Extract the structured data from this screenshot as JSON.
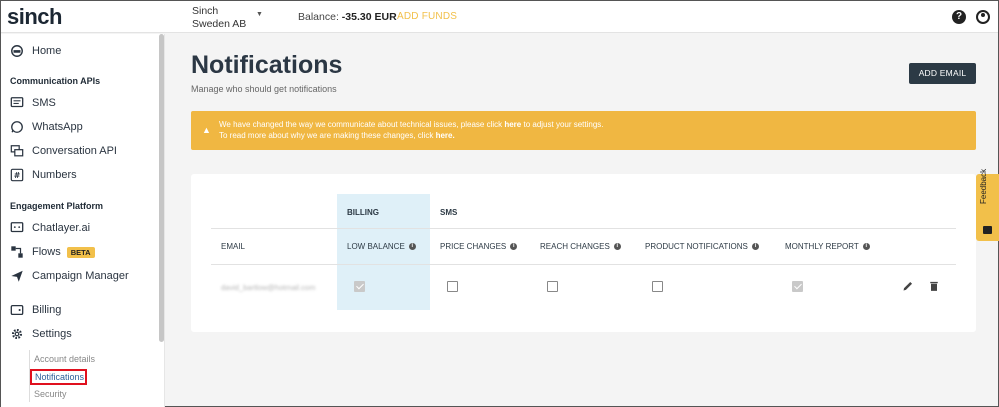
{
  "header": {
    "logo": "sinch",
    "account": "Sinch Sweden AB",
    "balance_label": "Balance:",
    "balance_value": "-35.30 EUR",
    "add_funds": "ADD FUNDS"
  },
  "sidebar": {
    "home": "Home",
    "section1": "Communication APIs",
    "sms": "SMS",
    "whatsapp": "WhatsApp",
    "conversation": "Conversation API",
    "numbers": "Numbers",
    "section2": "Engagement Platform",
    "chatlayer": "Chatlayer.ai",
    "flows": "Flows",
    "flows_badge": "BETA",
    "campaign": "Campaign Manager",
    "billing": "Billing",
    "settings": "Settings",
    "sub": [
      "Account details",
      "Notifications",
      "Security"
    ]
  },
  "page": {
    "title": "Notifications",
    "subtitle": "Manage who should get notifications",
    "add_email": "ADD EMAIL"
  },
  "alert": {
    "line1_a": "We have changed the way we communicate about technical issues, please click ",
    "line1_link": "here",
    "line1_b": " to adjust your settings.",
    "line2_a": "To read more about why we are making these changes, click ",
    "line2_link": "here."
  },
  "table": {
    "groups": [
      "BILLING",
      "SMS"
    ],
    "columns": [
      "EMAIL",
      "LOW BALANCE",
      "PRICE CHANGES",
      "REACH CHANGES",
      "PRODUCT NOTIFICATIONS",
      "MONTHLY REPORT"
    ],
    "row": {
      "email": "david_bartlow@hotmail.com",
      "low_balance": true,
      "price_changes": false,
      "reach_changes": false,
      "product_notifications": false,
      "monthly_report": true
    }
  },
  "feedback": "Feedback"
}
